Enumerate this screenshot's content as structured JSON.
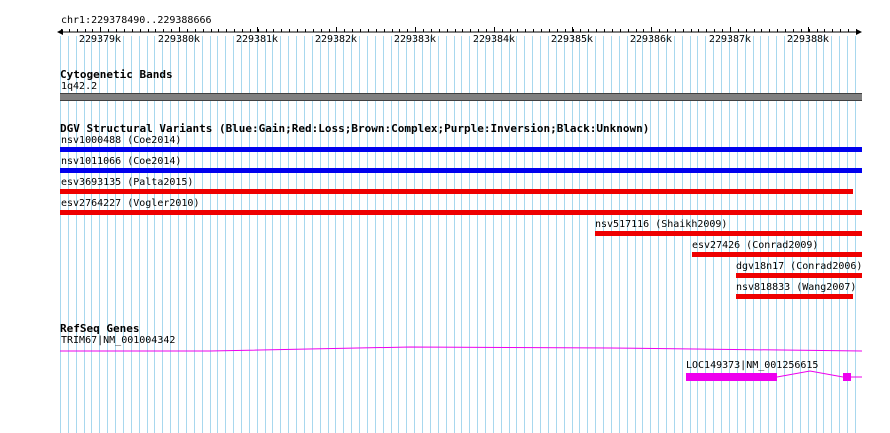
{
  "ruler": {
    "location": "chr1:229378490..229388666",
    "ticks": [
      "229379k",
      "229380k",
      "229381k",
      "229382k",
      "229383k",
      "229384k",
      "229385k",
      "229386k",
      "229387k",
      "229388k"
    ]
  },
  "cytoband": {
    "title": "Cytogenetic Bands",
    "band_label": "1q42.2",
    "color": "#808080"
  },
  "dgv": {
    "title": "DGV Structural Variants (Blue:Gain;Red:Loss;Brown:Complex;Purple:Inversion;Black:Unknown)",
    "features": [
      {
        "label": "nsv1000488 (Coe2014)",
        "type": "gain",
        "color": "#0000ee"
      },
      {
        "label": "nsv1011066 (Coe2014)",
        "type": "gain",
        "color": "#0000ee"
      },
      {
        "label": "esv3693135 (Palta2015)",
        "type": "loss",
        "color": "#ee0000"
      },
      {
        "label": "esv2764227 (Vogler2010)",
        "type": "loss",
        "color": "#ee0000"
      },
      {
        "label": "nsv517116 (Shaikh2009)",
        "type": "loss",
        "color": "#ee0000"
      },
      {
        "label": "esv27426 (Conrad2009)",
        "type": "loss",
        "color": "#ee0000"
      },
      {
        "label": "dgv18n17 (Conrad2006)",
        "type": "loss",
        "color": "#ee0000"
      },
      {
        "label": "nsv818833 (Wang2007)",
        "type": "loss",
        "color": "#ee0000"
      }
    ]
  },
  "refseq": {
    "title": "RefSeq Genes",
    "color": "#ee00ee",
    "genes": [
      {
        "label": "TRIM67|NM_001004342"
      },
      {
        "label": "LOC149373|NM_001256615"
      }
    ]
  },
  "colors": {
    "grid_line": "#a8d8ee",
    "gain": "#0000ee",
    "loss": "#ee0000",
    "gene": "#ee00ee",
    "band": "#808080"
  }
}
